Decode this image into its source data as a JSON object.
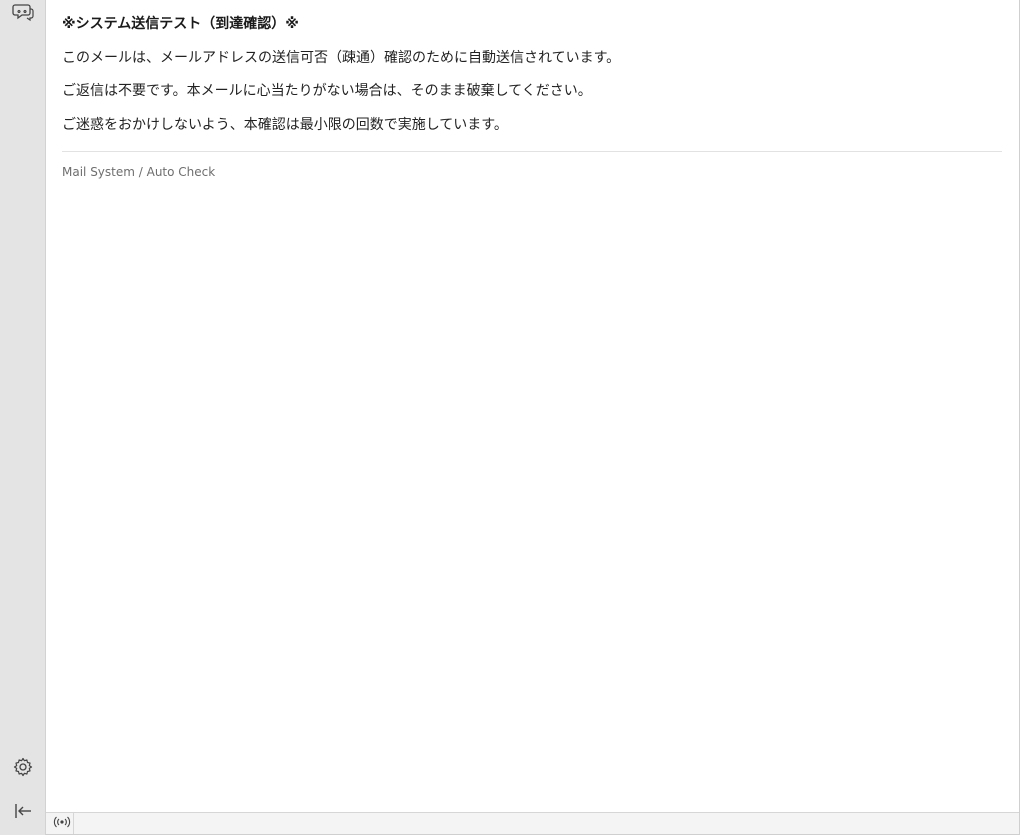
{
  "sidebar": {
    "icons": {
      "chat": "chat-bubbles-icon",
      "settings": "gear-icon",
      "collapse": "collapse-left-icon"
    }
  },
  "message": {
    "subject": "※システム送信テスト（到達確認）※",
    "paragraphs": [
      "このメールは、メールアドレスの送信可否（疎通）確認のために自動送信されています。",
      "ご返信は不要です。本メールに心当たりがない場合は、そのまま破棄してください。",
      "ご迷惑をおかけしないよう、本確認は最小限の回数で実施しています。"
    ],
    "signature": "Mail System / Auto Check"
  },
  "statusbar": {
    "icon": "broadcast-icon"
  },
  "colors": {
    "sidebar_bg": "#e4e4e4",
    "text": "#222222",
    "muted": "#6e6e6e"
  }
}
